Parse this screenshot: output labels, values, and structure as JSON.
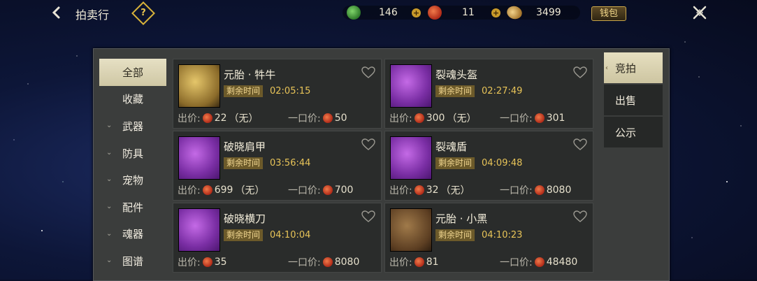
{
  "header": {
    "title": "拍卖行",
    "help_symbol": "?",
    "currencies": [
      {
        "icon": "jade-coin-icon",
        "value": "146"
      },
      {
        "icon": "red-gem-icon",
        "value": "11"
      },
      {
        "icon": "gold-bean-icon",
        "value": "3499"
      }
    ],
    "plus_symbol": "+",
    "wallet_label": "钱包"
  },
  "categories": [
    {
      "label": "全部",
      "active": true,
      "expandable": false
    },
    {
      "label": "收藏",
      "active": false,
      "expandable": false
    },
    {
      "label": "武器",
      "active": false,
      "expandable": true
    },
    {
      "label": "防具",
      "active": false,
      "expandable": true
    },
    {
      "label": "宠物",
      "active": false,
      "expandable": true
    },
    {
      "label": "配件",
      "active": false,
      "expandable": true
    },
    {
      "label": "魂器",
      "active": false,
      "expandable": true
    },
    {
      "label": "图谱",
      "active": false,
      "expandable": true
    }
  ],
  "listing_labels": {
    "remaining_time": "剩余时间",
    "bid_price": "出价:",
    "buyout_price": "一口价:"
  },
  "items": [
    {
      "name": "元胎 · 牪牛",
      "time": "02:05:15",
      "bid": "22",
      "bid_note": "（无）",
      "buyout": "50",
      "thumb": "gold"
    },
    {
      "name": "裂魂头盔",
      "time": "02:27:49",
      "bid": "300",
      "bid_note": "（无）",
      "buyout": "301",
      "thumb": "purple"
    },
    {
      "name": "破晓肩甲",
      "time": "03:56:44",
      "bid": "699",
      "bid_note": "（无）",
      "buyout": "700",
      "thumb": "purple"
    },
    {
      "name": "裂魂盾",
      "time": "04:09:48",
      "bid": "32",
      "bid_note": "（无）",
      "buyout": "8080",
      "thumb": "purple"
    },
    {
      "name": "破晓横刀",
      "time": "04:10:04",
      "bid": "35",
      "bid_note": "",
      "buyout": "8080",
      "thumb": "purple"
    },
    {
      "name": "元胎 · 小黑",
      "time": "04:10:23",
      "bid": "81",
      "bid_note": "",
      "buyout": "48480",
      "thumb": "brown"
    }
  ],
  "tabs": [
    {
      "label": "竞拍",
      "active": true
    },
    {
      "label": "出售",
      "active": false
    },
    {
      "label": "公示",
      "active": false
    }
  ],
  "colors": {
    "accent_gold": "#e8c458",
    "active_tab": "#e6dfc0",
    "price_gem": "#c8391f"
  }
}
